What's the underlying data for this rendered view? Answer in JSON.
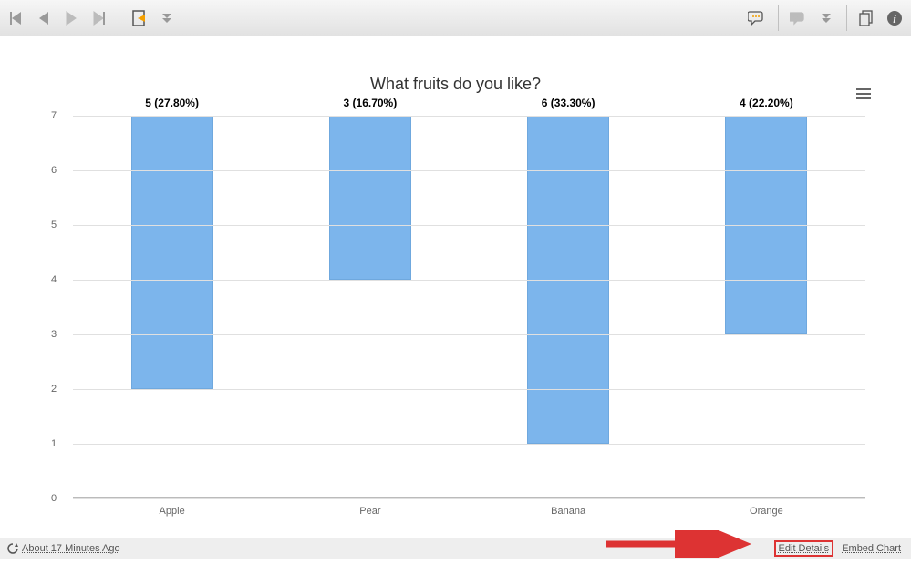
{
  "toolbar": {
    "first_tip": "First",
    "prev_tip": "Previous",
    "next_tip": "Next",
    "last_tip": "Last"
  },
  "chart_data": {
    "type": "bar",
    "title": "What fruits do you like?",
    "categories": [
      "Apple",
      "Pear",
      "Banana",
      "Orange"
    ],
    "values": [
      5,
      3,
      6,
      4
    ],
    "percents": [
      "27.80%",
      "16.70%",
      "33.30%",
      "22.20%"
    ],
    "ylim": [
      0,
      7
    ],
    "yticks": [
      0,
      1,
      2,
      3,
      4,
      5,
      6,
      7
    ]
  },
  "footer": {
    "timestamp": "About 17 Minutes Ago",
    "edit_details": "Edit Details",
    "embed_chart": "Embed Chart"
  }
}
